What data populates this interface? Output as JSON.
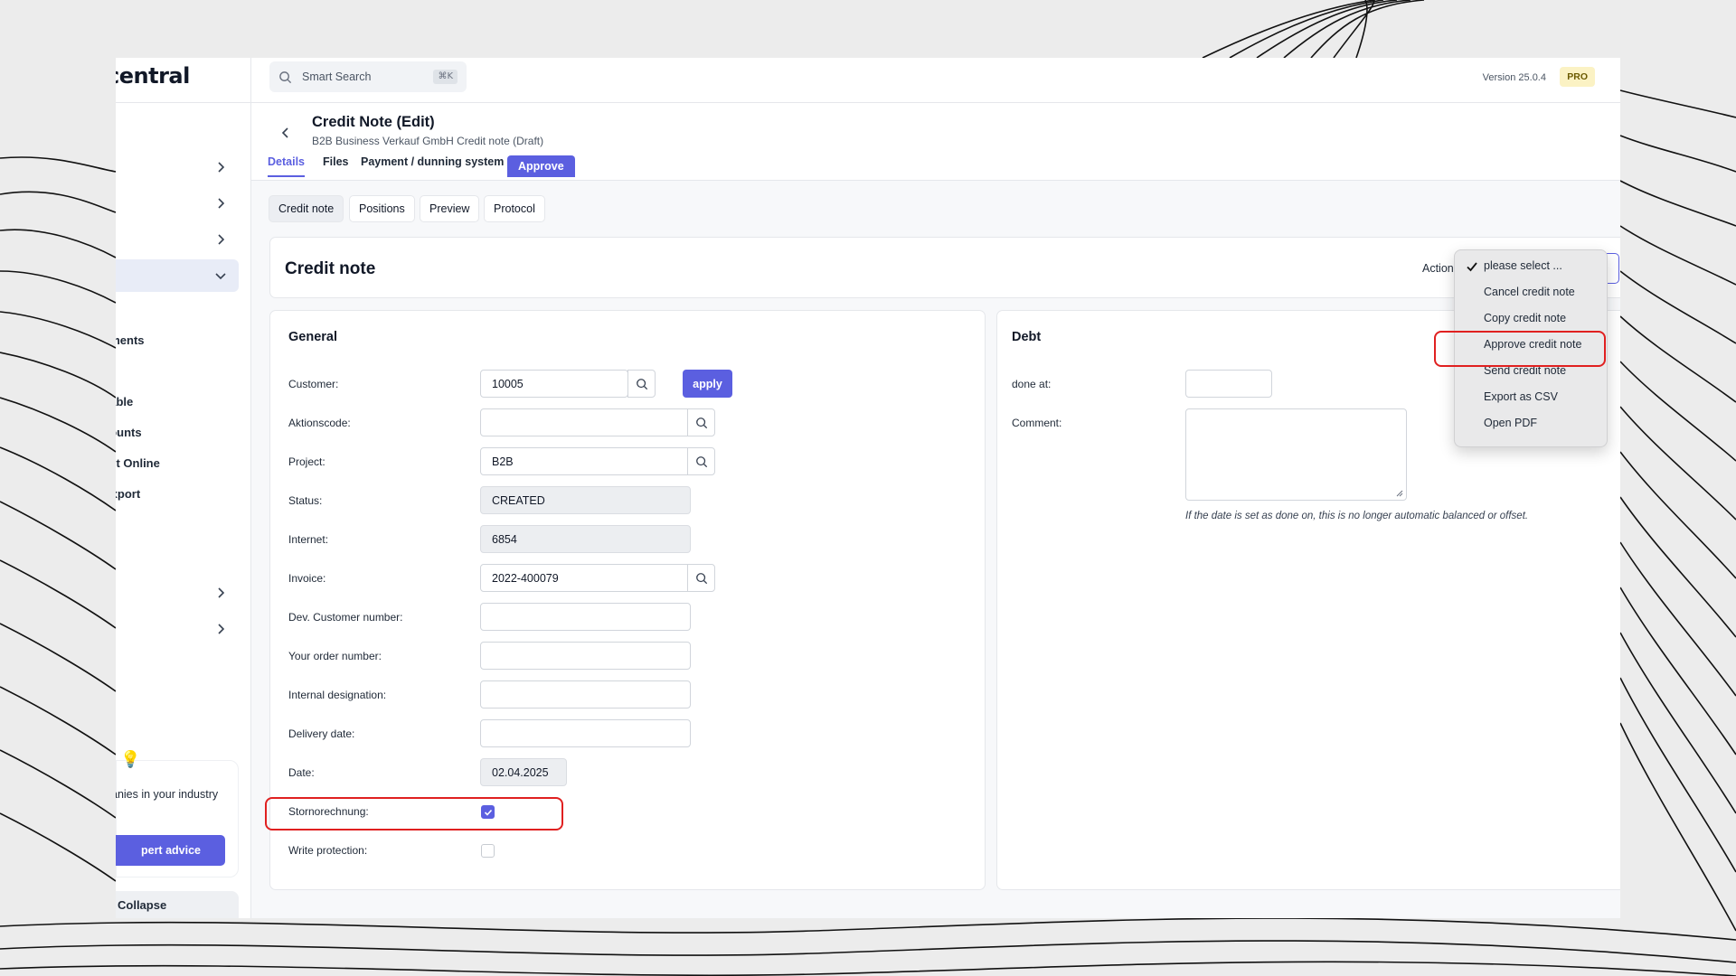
{
  "app": {
    "logo_text": "central",
    "search_placeholder": "Smart Search",
    "search_shortcut": "⌘K",
    "version": "Version 25.0.4",
    "plan_badge": "PRO"
  },
  "sidebar": {
    "submenu": [
      "yments",
      "",
      "yable",
      "counts",
      "ect Online",
      "Export"
    ],
    "advice_text": "anies in your industry",
    "advice_button": "pert advice",
    "collapse": "Collapse"
  },
  "page": {
    "title": "Credit Note (Edit)",
    "subtitle": "B2B Business Verkauf GmbH Credit note (Draft)",
    "tabs": [
      "Details",
      "Files",
      "Payment / dunning system"
    ],
    "approve_tab": "Approve",
    "subtabs": [
      "Credit note",
      "Positions",
      "Preview",
      "Protocol"
    ]
  },
  "credit_note_card": {
    "title": "Credit note",
    "action_label": "Action"
  },
  "general": {
    "title": "General",
    "labels": {
      "customer": "Customer:",
      "aktionscode": "Aktionscode:",
      "project": "Project:",
      "status": "Status:",
      "internet": "Internet:",
      "invoice": "Invoice:",
      "dev_customer": "Dev. Customer number:",
      "order_number": "Your order number:",
      "internal": "Internal designation:",
      "delivery": "Delivery date:",
      "date": "Date:",
      "storno": "Stornorechnung:",
      "write_protection": "Write protection:"
    },
    "values": {
      "customer": "10005",
      "aktionscode": "",
      "project": "B2B",
      "status": "CREATED",
      "internet": "6854",
      "invoice": "2022-400079",
      "dev_customer": "",
      "order_number": "",
      "internal": "",
      "delivery": "",
      "date": "02.04.2025"
    },
    "apply_button": "apply"
  },
  "debt": {
    "title": "Debt",
    "done_at_label": "done at:",
    "comment_label": "Comment:",
    "note": "If the date is set as done on, this is no longer automatic balanced or offset."
  },
  "action_menu": {
    "items": [
      "please select ...",
      "Cancel credit note",
      "Copy credit note",
      "Approve credit note",
      "Send credit note",
      "Export as CSV",
      "Open PDF"
    ]
  },
  "colors": {
    "accent": "#5b5fe0",
    "highlight": "#e02020",
    "plan_badge_bg": "#fbf2c4"
  }
}
